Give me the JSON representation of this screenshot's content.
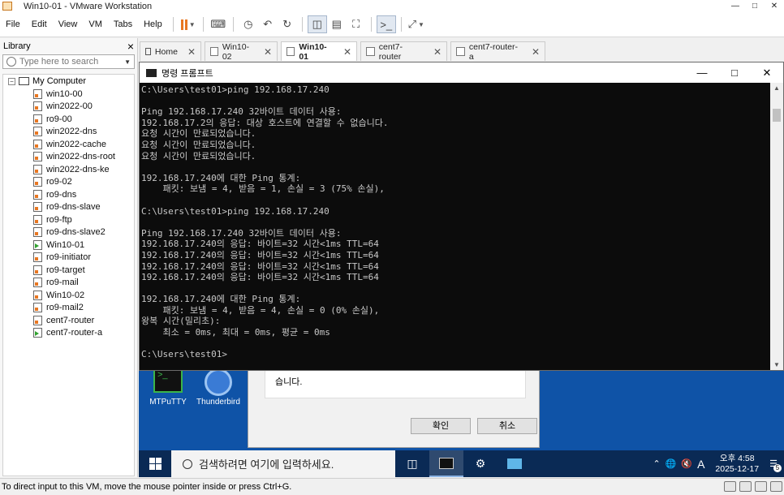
{
  "window": {
    "title": "Win10-01 - VMware Workstation"
  },
  "menu": {
    "items": [
      "File",
      "Edit",
      "View",
      "VM",
      "Tabs",
      "Help"
    ]
  },
  "library": {
    "title": "Library",
    "close": "×",
    "search_placeholder": "Type here to search",
    "root": "My Computer",
    "items": [
      {
        "name": "win10-00",
        "running": false
      },
      {
        "name": "win2022-00",
        "running": false
      },
      {
        "name": "ro9-00",
        "running": false
      },
      {
        "name": "win2022-dns",
        "running": false
      },
      {
        "name": "win2022-cache",
        "running": false
      },
      {
        "name": "win2022-dns-root",
        "running": false
      },
      {
        "name": "win2022-dns-ke",
        "running": false
      },
      {
        "name": "ro9-02",
        "running": false
      },
      {
        "name": "ro9-dns",
        "running": false
      },
      {
        "name": "ro9-dns-slave",
        "running": false
      },
      {
        "name": "ro9-ftp",
        "running": false
      },
      {
        "name": "ro9-dns-slave2",
        "running": false
      },
      {
        "name": "Win10-01",
        "running": true
      },
      {
        "name": "ro9-initiator",
        "running": false
      },
      {
        "name": "ro9-target",
        "running": false
      },
      {
        "name": "ro9-mail",
        "running": false
      },
      {
        "name": "Win10-02",
        "running": false
      },
      {
        "name": "ro9-mail2",
        "running": false
      },
      {
        "name": "cent7-router",
        "running": false
      },
      {
        "name": "cent7-router-a",
        "running": true
      }
    ]
  },
  "tabs": [
    {
      "label": "Home",
      "active": false
    },
    {
      "label": "Win10-02",
      "active": false
    },
    {
      "label": "Win10-01",
      "active": true
    },
    {
      "label": "cent7-router",
      "active": false
    },
    {
      "label": "cent7-router-a",
      "active": false
    }
  ],
  "cmd": {
    "title": "명령 프롬프트",
    "lines": [
      "C:\\Users\\test01>ping 192.168.17.240",
      "",
      "Ping 192.168.17.240 32바이트 데이터 사용:",
      "192.168.17.2의 응답: 대상 호스트에 연결할 수 없습니다.",
      "요청 시간이 만료되었습니다.",
      "요청 시간이 만료되었습니다.",
      "요청 시간이 만료되었습니다.",
      "",
      "192.168.17.240에 대한 Ping 통계:",
      "    패킷: 보냄 = 4, 받음 = 1, 손실 = 3 (75% 손실),",
      "",
      "C:\\Users\\test01>ping 192.168.17.240",
      "",
      "Ping 192.168.17.240 32바이트 데이터 사용:",
      "192.168.17.240의 응답: 바이트=32 시간<1ms TTL=64",
      "192.168.17.240의 응답: 바이트=32 시간<1ms TTL=64",
      "192.168.17.240의 응답: 바이트=32 시간<1ms TTL=64",
      "192.168.17.240의 응답: 바이트=32 시간<1ms TTL=64",
      "",
      "192.168.17.240에 대한 Ping 통계:",
      "    패킷: 보냄 = 4, 받음 = 4, 손실 = 0 (0% 손실),",
      "왕복 시간(밀리초):",
      "    최소 = 0ms, 최대 = 0ms, 평균 = 0ms",
      "",
      "C:\\Users\\test01>"
    ]
  },
  "desktop": {
    "icons": [
      "MTPuTTY",
      "Thunderbird"
    ],
    "dialog": {
      "message": "습니다.",
      "ok": "확인",
      "cancel": "취소"
    }
  },
  "taskbar": {
    "search_placeholder": "검색하려면 여기에 입력하세요.",
    "time": "오후 4:58",
    "date": "2025-12-17",
    "ime": "A",
    "notifications": "5"
  },
  "status": {
    "text": "To direct input to this VM, move the mouse pointer inside or press Ctrl+G."
  }
}
